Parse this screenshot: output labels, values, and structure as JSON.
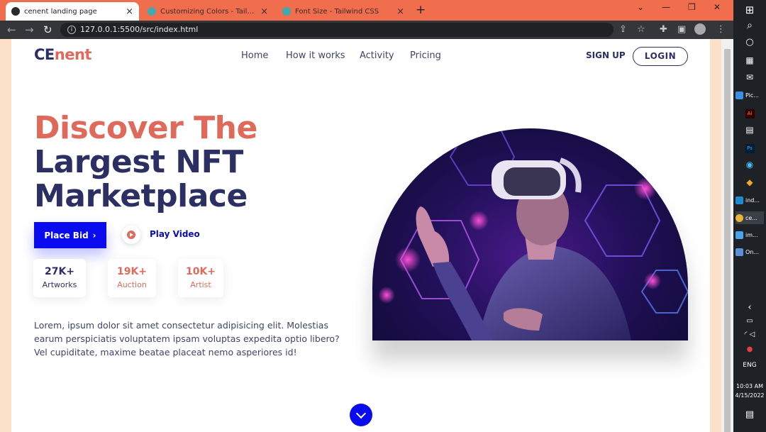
{
  "browser": {
    "tabs": [
      {
        "title": "cenent landing page",
        "active": true
      },
      {
        "title": "Customizing Colors - Tailwind CSS",
        "active": false
      },
      {
        "title": "Font Size - Tailwind CSS",
        "active": false
      }
    ],
    "new_tab": "+",
    "close": "×",
    "url": "127.0.0.1:5500/src/index.html",
    "window_controls": {
      "dropdown": "⌄",
      "minimize": "—",
      "restore": "❐",
      "close": "✕"
    }
  },
  "header": {
    "logo": {
      "part1": "CE",
      "part2": "nent"
    },
    "nav": [
      "Home",
      "How it works",
      "Activity",
      "Pricing"
    ],
    "signup": "SIGN UP",
    "login": "LOGIN"
  },
  "hero": {
    "line1": "Discover The",
    "line2": "Largest NFT",
    "line3": "Marketplace",
    "place_bid": "Place Bid",
    "play_video": "Play Video",
    "stats": [
      {
        "value": "27K+",
        "label": "Artworks"
      },
      {
        "value": "19K+",
        "label": "Auction"
      },
      {
        "value": "10K+",
        "label": "Artist"
      }
    ],
    "paragraph": "Lorem, ipsum dolor sit amet consectetur adipisicing elit. Molestias earum perspiciatis voluptatem ipsam voluptas expedita optio libero? Vel cupiditate, maxime beatae placeat nemo asperiores id!"
  },
  "taskbar": {
    "apps": [
      "Pic...",
      "ind...",
      "ce...",
      "im...",
      "On..."
    ],
    "lang": "ENG",
    "time": "10:03 AM",
    "date": "4/15/2022"
  },
  "colors": {
    "navy": "#2b2f63",
    "coral": "#df6a5c",
    "blue": "#0b0bef",
    "tabbar": "#f06d4d"
  }
}
